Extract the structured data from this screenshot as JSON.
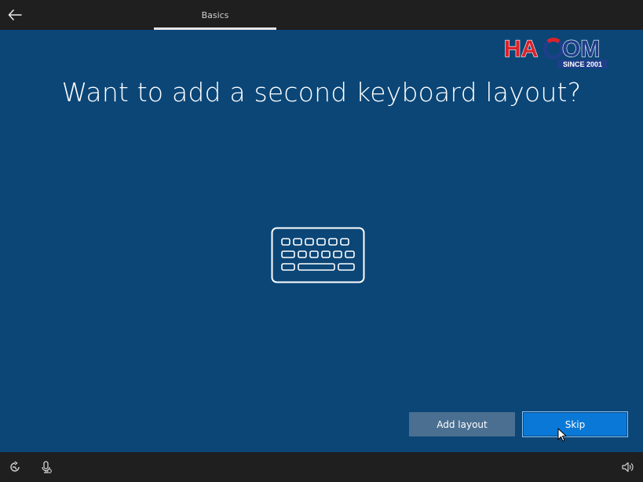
{
  "header": {
    "section_title": "Basics"
  },
  "branding": {
    "logo_text": "HACOM",
    "logo_subtext": "SINCE 2001"
  },
  "main": {
    "title": "Want to add a second keyboard layout?"
  },
  "actions": {
    "add_layout_label": "Add layout",
    "skip_label": "Skip"
  },
  "icons": {
    "back": "back-arrow-icon",
    "illustration": "keyboard-icon",
    "ease_of_access": "ease-of-access-icon",
    "microphone": "microphone-icon",
    "volume": "volume-icon"
  },
  "colors": {
    "background": "#0b4677",
    "bars": "#1f1f1f",
    "secondary_button": "#4a6f91",
    "primary_button": "#0a78d7",
    "logo_red": "#d8232a",
    "logo_blue": "#1e3f8a"
  }
}
